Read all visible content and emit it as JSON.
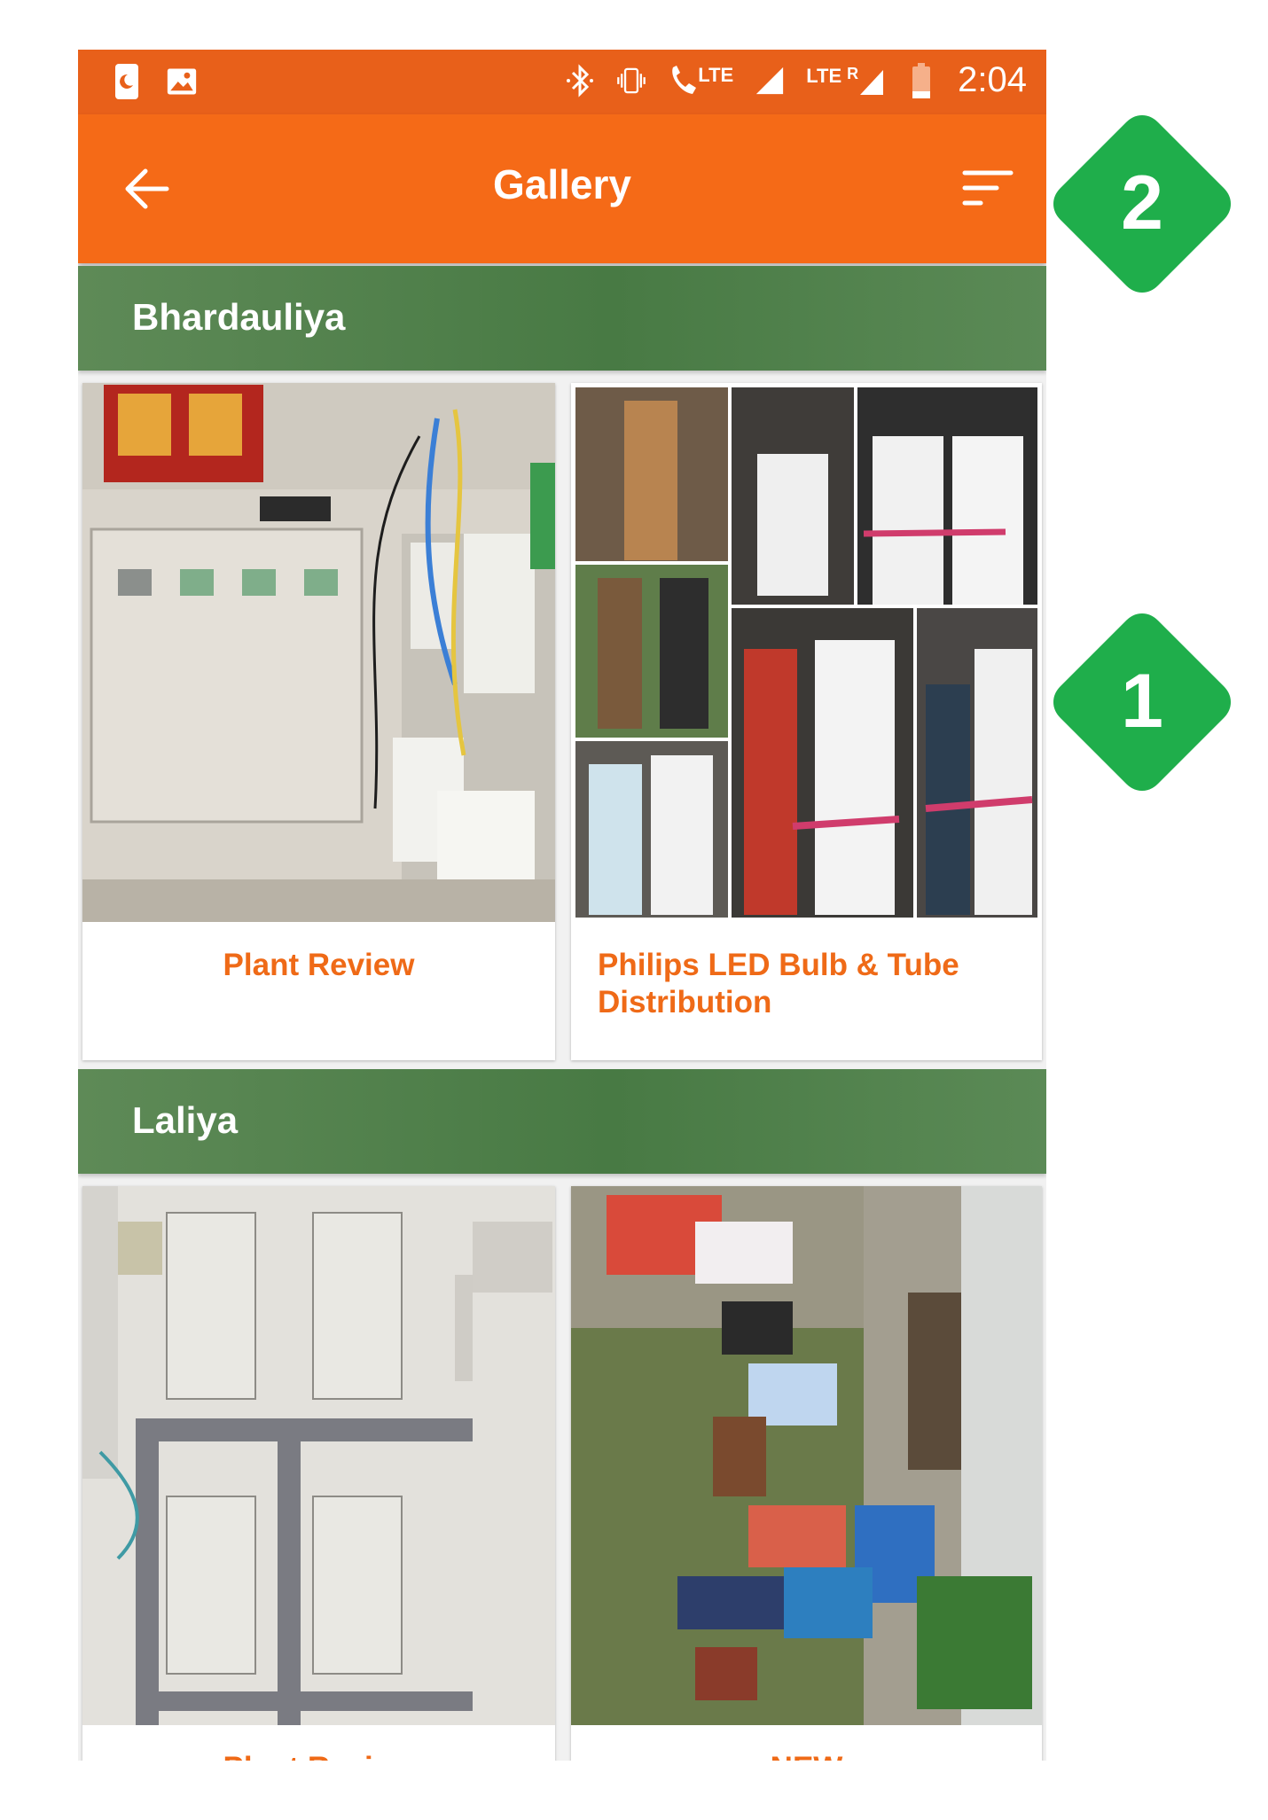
{
  "status_bar": {
    "left_icons": [
      "phone-icon",
      "image-icon"
    ],
    "right_icons": [
      "bluetooth-icon",
      "vibrate-icon",
      "volte-call-icon",
      "signal-icon",
      "signal-roaming-icon",
      "battery-low-icon"
    ],
    "lte_label": "LTE",
    "lte_label_2": "LTE",
    "roaming_label": "R",
    "time": "2:04"
  },
  "app_bar": {
    "title": "Gallery",
    "back_icon": "arrow-left-icon",
    "sort_icon": "sort-icon",
    "color": "#f56a17"
  },
  "sections": [
    {
      "title": "Bhardauliya",
      "cards": [
        {
          "caption": "Plant Review"
        },
        {
          "caption": "Philips LED Bulb & Tube Distribution"
        }
      ]
    },
    {
      "title": "Laliya",
      "cards": [
        {
          "caption": "Plant Review"
        },
        {
          "caption": "NEW"
        }
      ]
    }
  ],
  "callouts": [
    {
      "label": "2",
      "color": "#1fae4b"
    },
    {
      "label": "1",
      "color": "#1fae4b"
    }
  ],
  "colors": {
    "accent": "#f56a17",
    "section_header": "#487a44",
    "caption": "#ef6a17"
  }
}
